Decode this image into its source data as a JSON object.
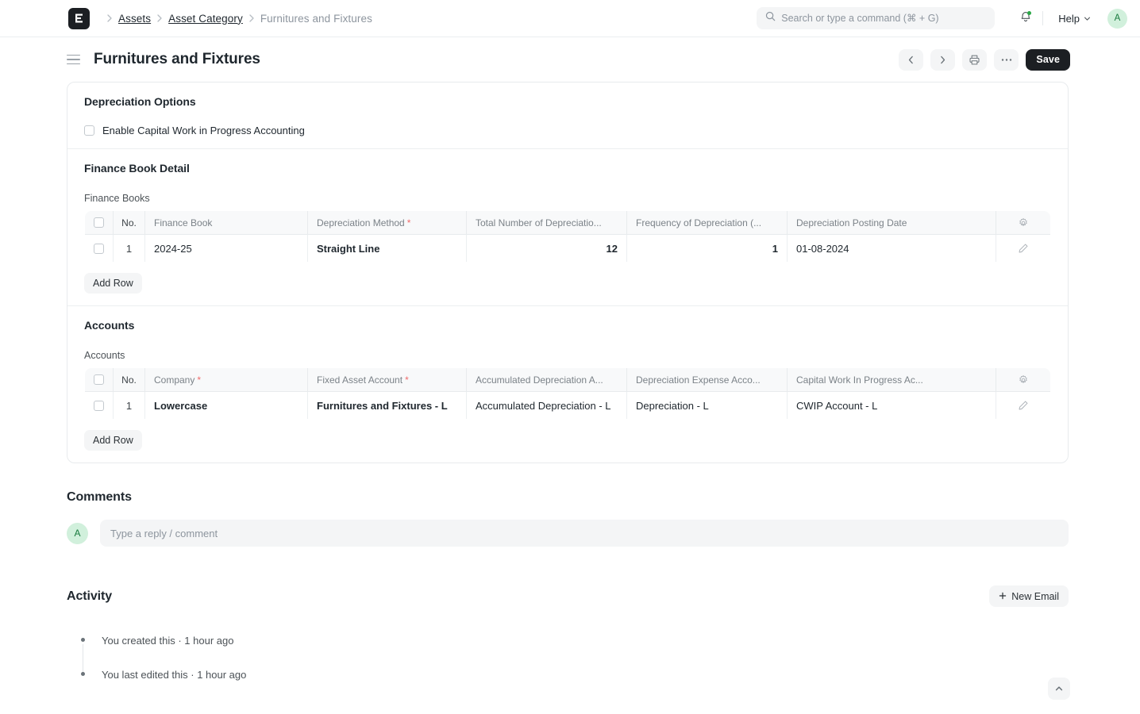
{
  "navbar": {
    "logo_icon": "erpnext-logo-icon",
    "breadcrumb": [
      {
        "label": "Assets",
        "muted": false
      },
      {
        "label": "Asset Category",
        "muted": false
      },
      {
        "label": "Furnitures and Fixtures",
        "muted": true
      }
    ],
    "search": {
      "placeholder": "Search or type a command (⌘ + G)",
      "value": "",
      "icon": "search-icon"
    },
    "notifications": {
      "icon": "bell-icon",
      "has_unread": true,
      "dot_color": "#28a745"
    },
    "help": {
      "label": "Help",
      "icon": "chevron-down-icon"
    },
    "avatar": {
      "initial": "A",
      "bg": "#d1f0dc",
      "fg": "#177a3d"
    }
  },
  "page_head": {
    "menu_icon": "hamburger-icon",
    "title": "Furnitures and Fixtures",
    "actions": {
      "prev_icon": "chevron-left-icon",
      "next_icon": "chevron-right-icon",
      "print_icon": "printer-icon",
      "more_icon": "ellipsis-icon",
      "save_label": "Save"
    }
  },
  "depreciation_options": {
    "title": "Depreciation Options",
    "checkbox": {
      "label": "Enable Capital Work in Progress Accounting",
      "checked": false
    }
  },
  "finance_book_detail": {
    "title": "Finance Book Detail",
    "grid_label": "Finance Books",
    "columns": [
      {
        "label": "No."
      },
      {
        "label": "Finance Book",
        "required": false
      },
      {
        "label": "Depreciation Method",
        "required": true
      },
      {
        "label": "Total Number of Depreciatio...",
        "required": false
      },
      {
        "label": "Frequency of Depreciation (...",
        "required": false
      },
      {
        "label": "Depreciation Posting Date",
        "required": false
      }
    ],
    "rows": [
      {
        "no": "1",
        "finance_book": "2024-25",
        "depreciation_method": "Straight Line",
        "total_number_of_depreciations": "12",
        "frequency_of_depreciation": "1",
        "depreciation_posting_date": "01-08-2024"
      }
    ],
    "settings_icon": "gear-icon",
    "edit_icon": "pencil-icon",
    "add_row_label": "Add Row"
  },
  "accounts": {
    "title": "Accounts",
    "grid_label": "Accounts",
    "columns": [
      {
        "label": "No."
      },
      {
        "label": "Company",
        "required": true
      },
      {
        "label": "Fixed Asset Account",
        "required": true
      },
      {
        "label": "Accumulated Depreciation A...",
        "required": false
      },
      {
        "label": "Depreciation Expense Acco...",
        "required": false
      },
      {
        "label": "Capital Work In Progress Ac...",
        "required": false
      }
    ],
    "rows": [
      {
        "no": "1",
        "company": "Lowercase",
        "fixed_asset_account": "Furnitures and Fixtures - L",
        "accumulated_depreciation_account": "Accumulated Depreciation - L",
        "depreciation_expense_account": "Depreciation - L",
        "capital_work_in_progress_account": "CWIP Account - L"
      }
    ],
    "settings_icon": "gear-icon",
    "edit_icon": "pencil-icon",
    "add_row_label": "Add Row"
  },
  "comments": {
    "title": "Comments",
    "avatar": {
      "initial": "A"
    },
    "input": {
      "placeholder": "Type a reply / comment",
      "value": ""
    }
  },
  "activity": {
    "title": "Activity",
    "new_email_label": "New Email",
    "new_email_icon": "plus-icon",
    "items": [
      {
        "text": "You created this · 1 hour ago"
      },
      {
        "text": "You last edited this · 1 hour ago"
      }
    ]
  },
  "scroll_top": {
    "icon": "chevron-up-icon"
  }
}
